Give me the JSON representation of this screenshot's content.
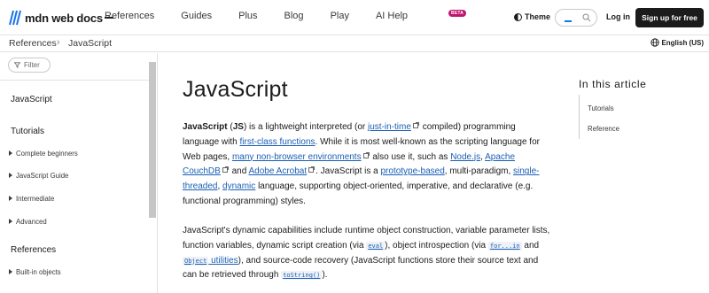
{
  "nav": {
    "logo_text": "mdn web docs",
    "links": [
      "References",
      "Guides",
      "Plus",
      "Blog",
      "Play",
      "AI Help"
    ],
    "ai_badge": "BETA",
    "theme_label": "Theme",
    "login_label": "Log in",
    "signup_label": "Sign up for free"
  },
  "breadcrumb": {
    "items": [
      "References",
      "JavaScript"
    ],
    "separator": "›",
    "language": "English (US)"
  },
  "sidebar": {
    "filter_placeholder": "Filter",
    "sections": [
      {
        "label": "JavaScript"
      },
      {
        "label": "Tutorials"
      },
      {
        "label": "References"
      }
    ],
    "items": [
      "Complete beginners",
      "JavaScript Guide",
      "Intermediate",
      "Advanced",
      "Built-in objects"
    ]
  },
  "article": {
    "title": "JavaScript",
    "p1": {
      "bold1": "JavaScript",
      "t1": " (",
      "bold2": "JS",
      "t2": ") is a lightweight interpreted (or ",
      "link1": "just-in-time",
      "t3": " compiled) programming language with ",
      "link2": "first-class functions",
      "t4": ". While it is most well-known as the scripting language for Web pages, ",
      "link3": "many non-browser environments",
      "t5": " also use it, such as ",
      "link4": "Node.js",
      "t6": ", ",
      "link5": "Apache CouchDB",
      "t7": " and ",
      "link6": "Adobe Acrobat",
      "t8": ". JavaScript is a ",
      "link7": "prototype-based",
      "t9": ", multi-paradigm, ",
      "link8": "single-threaded",
      "t10": ", ",
      "link9": "dynamic",
      "t11": " language, supporting object-oriented, imperative, and declarative (e.g. functional programming) styles."
    },
    "p2": {
      "t1": "JavaScript's dynamic capabilities include runtime object construction, variable parameter lists, function variables, dynamic script creation (via ",
      "code1": "eval",
      "t2": "), object introspection (via ",
      "code2": "for...in",
      "t3": " and ",
      "code3": "Object",
      "link1": " utilities",
      "t4": "), and source-code recovery (JavaScript functions store their source text and can be retrieved through ",
      "code4": "toString()",
      "t5": ")."
    }
  },
  "toc": {
    "title": "In this article",
    "items": [
      "Tutorials",
      "Reference"
    ]
  },
  "colors": {
    "link": "#1a5fb4",
    "brand_blue": "#1a73e8",
    "badge": "#c0156f",
    "signup_bg": "#1b1b1b"
  }
}
